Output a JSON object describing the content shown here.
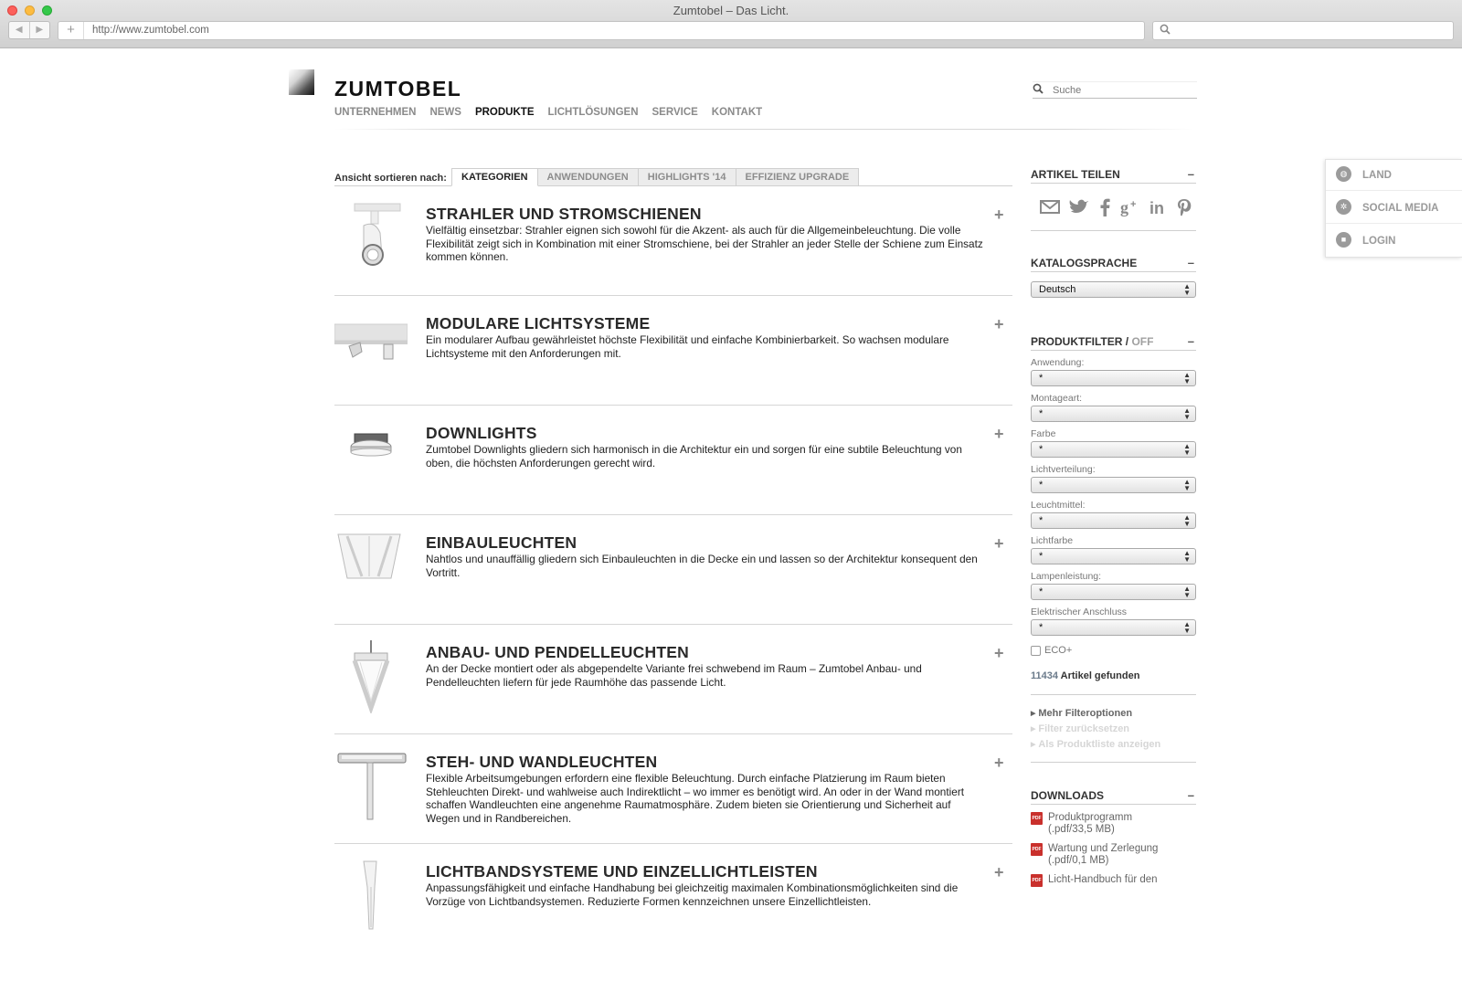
{
  "browser": {
    "title": "Zumtobel – Das Licht.",
    "url": "http://www.zumtobel.com",
    "new_tab": "+"
  },
  "header": {
    "logo": "ZUMTOBEL",
    "nav": [
      "UNTERNEHMEN",
      "NEWS",
      "PRODUKTE",
      "LICHTLÖSUNGEN",
      "SERVICE",
      "KONTAKT"
    ],
    "active_nav": "PRODUKTE",
    "search_placeholder": "Suche"
  },
  "sort": {
    "label": "Ansicht sortieren nach:",
    "tabs": [
      "KATEGORIEN",
      "ANWENDUNGEN",
      "HIGHLIGHTS '14",
      "EFFIZIENZ UPGRADE"
    ],
    "active_tab": "KATEGORIEN"
  },
  "categories": [
    {
      "title": "STRAHLER UND STROMSCHIENEN",
      "desc": "Vielfältig einsetzbar: Strahler eignen sich sowohl für die Akzent- als auch für die Allgemeinbeleuchtung. Die volle Flexibilität zeigt sich in Kombination mit einer Stromschiene, bei der Strahler an jeder Stelle der Schiene zum Einsatz kommen können.",
      "icon": "spotlight-icon"
    },
    {
      "title": "MODULARE LICHTSYSTEME",
      "desc": "Ein modularer Aufbau gewährleistet höchste Flexibilität und einfache Kombinierbarkeit. So wachsen modulare Lichtsysteme mit den Anforderungen mit.",
      "icon": "modular-light-icon"
    },
    {
      "title": "DOWNLIGHTS",
      "desc": "Zumtobel Downlights gliedern sich harmonisch in die Architektur ein und sorgen für eine subtile Beleuchtung von oben, die höchsten Anforderungen gerecht wird.",
      "icon": "downlight-icon"
    },
    {
      "title": "EINBAULEUCHTEN",
      "desc": "Nahtlos und unauffällig gliedern sich Einbauleuchten in die Decke ein und lassen so der Architektur konsequent den Vortritt.",
      "icon": "recessed-light-icon"
    },
    {
      "title": "ANBAU- UND PENDELLEUCHTEN",
      "desc": "An der Decke montiert oder als abgependelte Variante frei schwebend im Raum – Zumtobel Anbau- und Pendelleuchten liefern für jede Raumhöhe das passende Licht.",
      "icon": "pendant-light-icon"
    },
    {
      "title": "STEH- UND WANDLEUCHTEN",
      "desc": "Flexible Arbeitsumgebungen erfordern eine flexible Beleuchtung. Durch einfache Platzierung im Raum bieten Stehleuchten Direkt- und wahlweise auch Indirektlicht – wo immer es benötigt wird. An oder in der Wand montiert schaffen Wandleuchten eine angenehme Raumatmosphäre. Zudem bieten sie Orientierung und Sicherheit auf Wegen und in Randbereichen.",
      "icon": "floor-lamp-icon"
    },
    {
      "title": "LICHTBANDSYSTEME UND EINZELLICHTLEISTEN",
      "desc": "Anpassungsfähigkeit und einfache Handhabung bei gleichzeitig maximalen Kombinationsmöglichkeiten sind die Vorzüge von Lichtbandsystemen. Reduzierte Formen kennzeichnen unsere Einzellichtleisten.",
      "icon": "light-line-icon"
    }
  ],
  "sidebar": {
    "share_title": "ARTIKEL TEILEN",
    "collapse": "–",
    "share_icons": [
      "mail-icon",
      "twitter-icon",
      "facebook-icon",
      "googleplus-icon",
      "linkedin-icon",
      "pinterest-icon"
    ],
    "language_title": "KATALOGSPRACHE",
    "language_value": "Deutsch",
    "filter_title": "PRODUKTFILTER /",
    "filter_state": "OFF",
    "filters": [
      {
        "label": "Anwendung:",
        "value": "*"
      },
      {
        "label": "Montageart:",
        "value": "*"
      },
      {
        "label": "Farbe",
        "value": "*"
      },
      {
        "label": "Lichtverteilung:",
        "value": "*"
      },
      {
        "label": "Leuchtmittel:",
        "value": "*"
      },
      {
        "label": "Lichtfarbe",
        "value": "*"
      },
      {
        "label": "Lampenleistung:",
        "value": "*"
      },
      {
        "label": "Elektrischer Anschluss",
        "value": "*"
      }
    ],
    "eco_label": "ECO+",
    "found_count": "11434",
    "found_label": "Artikel gefunden",
    "links": [
      {
        "label": "Mehr Filteroptionen",
        "disabled": false
      },
      {
        "label": "Filter zurücksetzen",
        "disabled": true
      },
      {
        "label": "Als Produktliste anzeigen",
        "disabled": true
      }
    ],
    "downloads_title": "DOWNLOADS",
    "downloads": [
      {
        "name": "Produktprogramm",
        "meta": "(.pdf/33,5 MB)"
      },
      {
        "name": "Wartung und Zerlegung",
        "meta": "(.pdf/0,1 MB)"
      },
      {
        "name": "Licht-Handbuch für den",
        "meta": ""
      }
    ]
  },
  "float_panel": [
    {
      "label": "LAND",
      "icon": "globe-icon"
    },
    {
      "label": "SOCIAL MEDIA",
      "icon": "social-icon"
    },
    {
      "label": "LOGIN",
      "icon": "lock-icon"
    }
  ]
}
